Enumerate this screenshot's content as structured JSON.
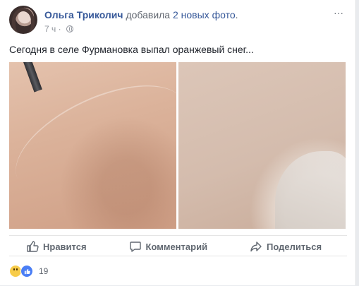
{
  "post": {
    "author": "Ольга Триколич",
    "action_prefix": "добавила",
    "action_link": "2 новых фото",
    "action_suffix": ".",
    "time": "7 ч",
    "menu_glyph": "···",
    "text": "Сегодня в селе Фурмановка выпал оранжевый снег..."
  },
  "actions": {
    "like": "Нравится",
    "comment": "Комментарий",
    "share": "Поделиться"
  },
  "reactions": {
    "types": [
      "wow",
      "like"
    ],
    "count": "19"
  },
  "icons": {
    "privacy": "globe-icon",
    "like": "thumbs-up-icon",
    "comment": "comment-bubble-icon",
    "share": "share-arrow-icon"
  }
}
